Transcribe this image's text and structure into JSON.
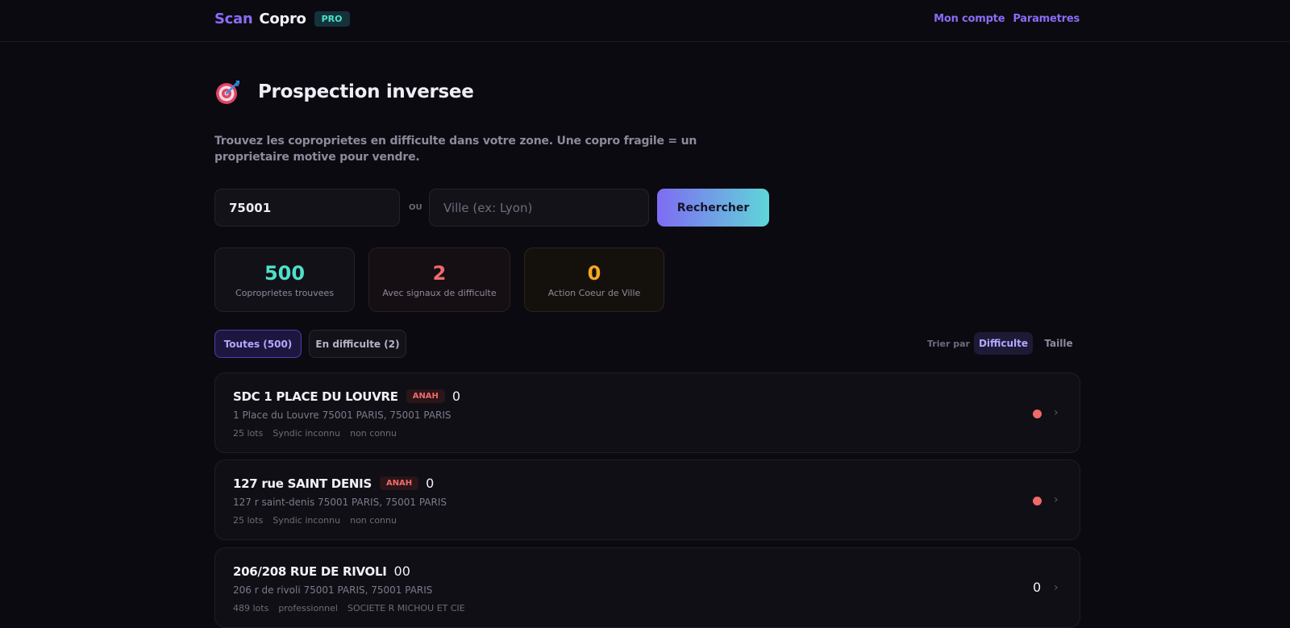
{
  "header": {
    "brand_scan": "Scan",
    "brand_copro": "Copro",
    "brand_badge": "PRO",
    "nav": [
      "Mon compte",
      "Parametres"
    ]
  },
  "page": {
    "icon": "target-icon",
    "title": "Prospection inversee",
    "subtitle": "Trouvez les coproprietes en difficulte dans votre zone. Une copro fragile = un proprietaire motive pour vendre."
  },
  "search": {
    "zip_value": "75001",
    "or_label": "OU",
    "city_placeholder": "Ville (ex: Lyon)",
    "button_label": "Rechercher"
  },
  "stats": [
    {
      "value": "500",
      "label": "Coproprietes trouvees",
      "color": "#4fe0c9"
    },
    {
      "value": "2",
      "label": "Avec signaux de difficulte",
      "color": "#f06a6a"
    },
    {
      "value": "0",
      "label": "Action Coeur de Ville",
      "color": "#f5a623"
    }
  ],
  "filters": {
    "all": "Toutes (500)",
    "difficulty": "En difficulte (2)",
    "sort_label": "Trier par :",
    "sort_options": [
      "Difficulte",
      "Taille"
    ],
    "sort_active": "Difficulte"
  },
  "results": [
    {
      "title": "SDC 1 PLACE DU LOUVRE",
      "badge": "ANAH",
      "number": "0",
      "address": "1 Place du Louvre 75001 PARIS, 75001 PARIS",
      "lots": "25 lots",
      "syndic": "Syndic inconnu",
      "status": "non connu",
      "indicator": "red-dot"
    },
    {
      "title": "127 rue SAINT DENIS",
      "badge": "ANAH",
      "number": "0",
      "address": "127 r saint-denis 75001 PARIS, 75001 PARIS",
      "lots": "25 lots",
      "syndic": "Syndic inconnu",
      "status": "non connu",
      "indicator": "red-dot"
    },
    {
      "title": "206/208 RUE DE RIVOLI",
      "number": "00",
      "address": "206 r de rivoli 75001 PARIS, 75001 PARIS",
      "lots": "489 lots",
      "syndic": "professionnel",
      "status": "SOCIETE R MICHOU ET CIE",
      "score": "0"
    }
  ],
  "colors": {
    "accent": "#8b6bf5",
    "teal": "#4fe0c9",
    "danger": "#f06a6a",
    "warning": "#f5a623",
    "background": "#0b0a10"
  }
}
